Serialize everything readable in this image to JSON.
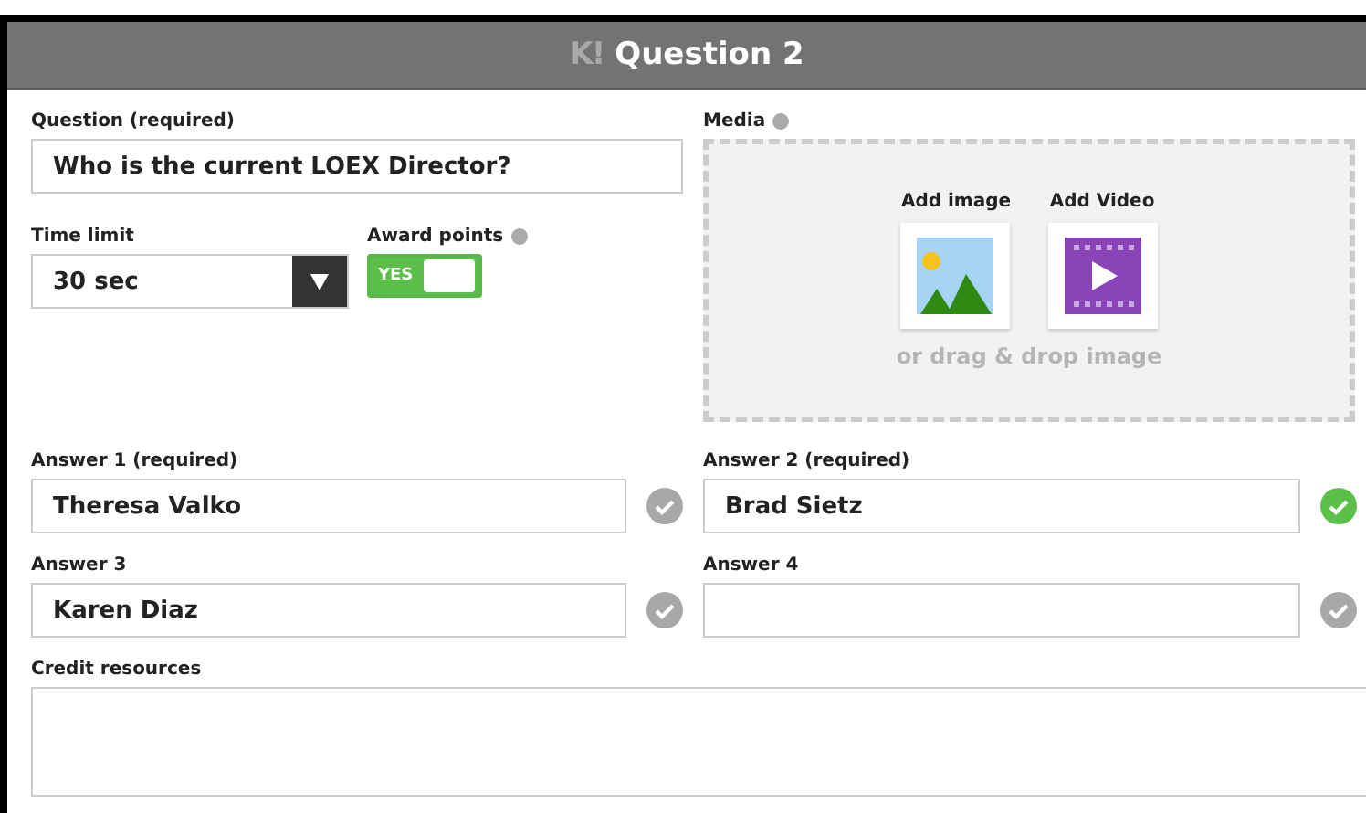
{
  "header": {
    "logo": "K!",
    "title": "Question 2"
  },
  "question": {
    "label": "Question (required)",
    "value": "Who is the current LOEX Director?"
  },
  "time_limit": {
    "label": "Time limit",
    "value": "30 sec"
  },
  "award_points": {
    "label": "Award points",
    "on": true,
    "on_text": "YES"
  },
  "media": {
    "label": "Media",
    "add_image": "Add image",
    "add_video": "Add Video",
    "hint": "or drag & drop image"
  },
  "answers": [
    {
      "label": "Answer 1 (required)",
      "value": "Theresa Valko",
      "correct": false
    },
    {
      "label": "Answer 2 (required)",
      "value": "Brad Sietz",
      "correct": true
    },
    {
      "label": "Answer 3",
      "value": "Karen Diaz",
      "correct": false
    },
    {
      "label": "Answer 4",
      "correct": false
    }
  ],
  "credit_resources": {
    "label": "Credit resources"
  }
}
